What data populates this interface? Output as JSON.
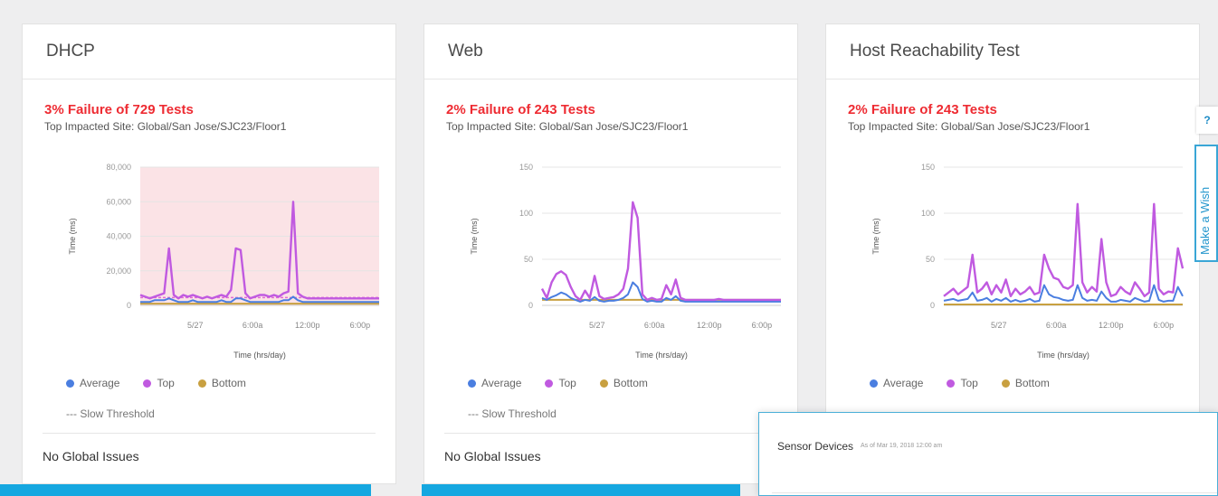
{
  "colors": {
    "average": "#4a7ee0",
    "top": "#c05ae0",
    "bottom": "#c8a040",
    "failure": "#ee2b32",
    "accent": "#15a7e0"
  },
  "cards": [
    {
      "title": "DHCP",
      "failure_text": "3% Failure of 729 Tests",
      "impacted_text": "Top Impacted Site: Global/San Jose/SJC23/Floor1",
      "legend": {
        "average": "Average",
        "top": "Top",
        "bottom": "Bottom"
      },
      "threshold_label": "--- Slow Threshold",
      "issues_text": "No Global Issues"
    },
    {
      "title": "Web",
      "failure_text": "2% Failure of 243 Tests",
      "impacted_text": "Top Impacted Site: Global/San Jose/SJC23/Floor1",
      "legend": {
        "average": "Average",
        "top": "Top",
        "bottom": "Bottom"
      },
      "threshold_label": "--- Slow Threshold",
      "issues_text": "No Global Issues"
    },
    {
      "title": "Host Reachability Test",
      "failure_text": "2% Failure of 243 Tests",
      "impacted_text": "Top Impacted Site: Global/San Jose/SJC23/Floor1",
      "legend": {
        "average": "Average",
        "top": "Top",
        "bottom": "Bottom"
      },
      "threshold_label": "",
      "issues_text": ""
    }
  ],
  "popup": {
    "title": "Sensor Devices",
    "subtitle": "As of Mar 19, 2018 12:00 am"
  },
  "side": {
    "help_label": "?",
    "wish_label": "Make a Wish"
  },
  "chart_data": [
    {
      "type": "line",
      "ylabel": "Time (ms)",
      "xlabel": "Time (hrs/day)",
      "yticks": [
        "80,000",
        "60,000",
        "40,000",
        "20,000",
        "0"
      ],
      "ymax": 80000,
      "xticks": [
        "5/27",
        "6:00a",
        "12:00p",
        "6:00p"
      ],
      "shaded": true,
      "x": [
        0,
        2,
        4,
        6,
        8,
        10,
        12,
        14,
        16,
        18,
        20,
        22,
        24,
        26,
        28,
        30,
        32,
        34,
        36,
        38,
        40,
        42,
        44,
        46,
        48,
        50,
        52,
        54,
        56,
        58,
        60,
        62,
        64,
        66,
        68,
        70,
        72,
        74,
        76,
        78,
        80,
        82,
        84,
        86,
        88,
        90,
        92,
        94,
        96,
        98,
        100
      ],
      "series": [
        {
          "name": "Top",
          "color_key": "top",
          "values": [
            6000,
            5000,
            4000,
            5000,
            6000,
            7000,
            33000,
            6000,
            4000,
            6000,
            5000,
            6000,
            5000,
            4000,
            5000,
            4000,
            5000,
            6000,
            5000,
            9000,
            33000,
            32000,
            7000,
            4000,
            5000,
            6000,
            6000,
            5000,
            6000,
            5000,
            7000,
            8000,
            60000,
            7000,
            5000,
            4000,
            4000,
            4000,
            4000,
            4000,
            4000,
            4000,
            4000,
            4000,
            4000,
            4000,
            4000,
            4000,
            4000,
            4000,
            4000
          ]
        },
        {
          "name": "Average",
          "color_key": "average",
          "values": [
            2000,
            2000,
            2000,
            3000,
            3000,
            3000,
            4000,
            3000,
            2000,
            2000,
            2000,
            3000,
            2000,
            2000,
            2000,
            2000,
            2000,
            3000,
            2000,
            2000,
            4000,
            4000,
            3000,
            2000,
            2000,
            2000,
            2000,
            2000,
            2000,
            2000,
            3000,
            3000,
            5000,
            3000,
            2000,
            2000,
            2000,
            2000,
            2000,
            2000,
            2000,
            2000,
            2000,
            2000,
            2000,
            2000,
            2000,
            2000,
            2000,
            2000,
            2000
          ]
        },
        {
          "name": "Bottom",
          "color_key": "bottom",
          "values": [
            1000,
            1000,
            1000,
            1000,
            1000,
            1000,
            1000,
            1000,
            1000,
            1000,
            1000,
            1000,
            1000,
            1000,
            1000,
            1000,
            1000,
            1000,
            1000,
            1000,
            1000,
            1000,
            1000,
            1000,
            1000,
            1000,
            1000,
            1000,
            1000,
            1000,
            1000,
            1000,
            1000,
            1000,
            1000,
            1000,
            1000,
            1000,
            1000,
            1000,
            1000,
            1000,
            1000,
            1000,
            1000,
            1000,
            1000,
            1000,
            1000,
            1000,
            1000
          ]
        }
      ]
    },
    {
      "type": "line",
      "ylabel": "Time (ms)",
      "xlabel": "Time (hrs/day)",
      "yticks": [
        "150",
        "100",
        "50",
        "0"
      ],
      "ymax": 150,
      "xticks": [
        "5/27",
        "6:00a",
        "12:00p",
        "6:00p"
      ],
      "shaded": false,
      "x": [
        0,
        2,
        4,
        6,
        8,
        10,
        12,
        14,
        16,
        18,
        20,
        22,
        24,
        26,
        28,
        30,
        32,
        34,
        36,
        38,
        40,
        42,
        44,
        46,
        48,
        50,
        52,
        54,
        56,
        58,
        60,
        62,
        64,
        66,
        68,
        70,
        72,
        74,
        76,
        78,
        80,
        82,
        84,
        86,
        88,
        90,
        92,
        94,
        96,
        98,
        100
      ],
      "series": [
        {
          "name": "Top",
          "color_key": "top",
          "values": [
            18,
            8,
            25,
            34,
            37,
            33,
            20,
            10,
            6,
            16,
            8,
            32,
            10,
            7,
            8,
            9,
            12,
            18,
            40,
            112,
            95,
            12,
            6,
            8,
            6,
            7,
            22,
            12,
            28,
            8,
            6,
            6,
            6,
            6,
            6,
            6,
            6,
            7,
            6,
            6,
            6,
            6,
            6,
            6,
            6,
            6,
            6,
            6,
            6,
            6,
            6
          ]
        },
        {
          "name": "Average",
          "color_key": "average",
          "values": [
            8,
            6,
            9,
            11,
            14,
            12,
            8,
            6,
            4,
            6,
            5,
            9,
            5,
            4,
            5,
            5,
            6,
            8,
            12,
            25,
            20,
            7,
            4,
            5,
            4,
            4,
            8,
            6,
            10,
            5,
            4,
            4,
            4,
            4,
            4,
            4,
            4,
            4,
            4,
            4,
            4,
            4,
            4,
            4,
            4,
            4,
            4,
            4,
            4,
            4,
            4
          ]
        },
        {
          "name": "Bottom",
          "color_key": "bottom",
          "values": [
            6,
            6,
            6,
            6,
            6,
            6,
            6,
            6,
            6,
            6,
            6,
            6,
            6,
            6,
            6,
            6,
            6,
            6,
            6,
            6,
            6,
            6,
            6,
            6,
            6,
            6,
            6,
            6,
            6,
            6,
            6,
            6,
            6,
            6,
            6,
            6,
            6,
            6,
            6,
            6,
            6,
            6,
            6,
            6,
            6,
            6,
            6,
            6,
            6,
            6,
            6
          ]
        }
      ]
    },
    {
      "type": "line",
      "ylabel": "Time (ms)",
      "xlabel": "Time (hrs/day)",
      "yticks": [
        "150",
        "100",
        "50",
        "0"
      ],
      "ymax": 150,
      "xticks": [
        "5/27",
        "6:00a",
        "12:00p",
        "6:00p"
      ],
      "shaded": false,
      "x": [
        0,
        2,
        4,
        6,
        8,
        10,
        12,
        14,
        16,
        18,
        20,
        22,
        24,
        26,
        28,
        30,
        32,
        34,
        36,
        38,
        40,
        42,
        44,
        46,
        48,
        50,
        52,
        54,
        56,
        58,
        60,
        62,
        64,
        66,
        68,
        70,
        72,
        74,
        76,
        78,
        80,
        82,
        84,
        86,
        88,
        90,
        92,
        94,
        96,
        98,
        100
      ],
      "series": [
        {
          "name": "Top",
          "color_key": "top",
          "values": [
            10,
            14,
            18,
            12,
            16,
            20,
            55,
            14,
            18,
            25,
            12,
            22,
            14,
            28,
            10,
            18,
            12,
            15,
            20,
            12,
            14,
            55,
            40,
            30,
            28,
            20,
            18,
            22,
            110,
            25,
            14,
            20,
            15,
            72,
            25,
            10,
            12,
            20,
            15,
            12,
            25,
            18,
            10,
            14,
            110,
            18,
            12,
            15,
            14,
            62,
            40
          ]
        },
        {
          "name": "Average",
          "color_key": "average",
          "values": [
            5,
            6,
            7,
            5,
            6,
            7,
            14,
            5,
            6,
            8,
            4,
            7,
            5,
            8,
            4,
            6,
            4,
            5,
            7,
            4,
            5,
            22,
            12,
            9,
            8,
            6,
            5,
            6,
            22,
            8,
            5,
            6,
            5,
            15,
            8,
            4,
            4,
            6,
            5,
            4,
            8,
            6,
            4,
            5,
            22,
            6,
            4,
            5,
            5,
            20,
            10
          ]
        },
        {
          "name": "Bottom",
          "color_key": "bottom",
          "values": [
            1,
            1,
            1,
            1,
            1,
            1,
            1,
            1,
            1,
            1,
            1,
            1,
            1,
            1,
            1,
            1,
            1,
            1,
            1,
            1,
            1,
            1,
            1,
            1,
            1,
            1,
            1,
            1,
            1,
            1,
            1,
            1,
            1,
            1,
            1,
            1,
            1,
            1,
            1,
            1,
            1,
            1,
            1,
            1,
            1,
            1,
            1,
            1,
            1,
            1,
            1
          ]
        }
      ]
    }
  ]
}
